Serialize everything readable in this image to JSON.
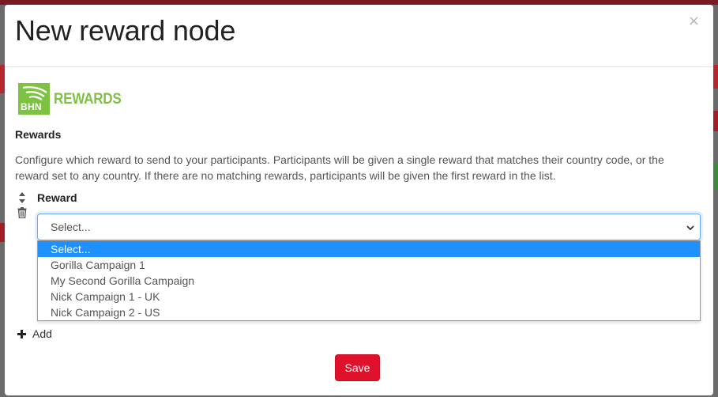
{
  "modal": {
    "title": "New reward node",
    "close_label": "×"
  },
  "logo": {
    "mark_text": "BHN",
    "wordmark": "REWARDS",
    "brand_color": "#7dc242"
  },
  "section": {
    "title": "Rewards",
    "description": "Configure which reward to send to your participants. Participants will be given a single reward that matches their country code, or the reward set to any country. If there are no matching rewards, participants will be given the first reward in the list."
  },
  "reward_field": {
    "label": "Reward",
    "selected_value": "Select...",
    "options": [
      "Select...",
      "Gorilla Campaign 1",
      "My Second Gorilla Campaign",
      "Nick Campaign 1 - UK",
      "Nick Campaign 2 - US"
    ],
    "highlighted_index": 0
  },
  "actions": {
    "add_label": "Add",
    "save_label": "Save"
  },
  "colors": {
    "accent_focus": "#66a8ec",
    "option_highlight": "#1e90ff",
    "save_button": "#e0112b"
  },
  "icons": [
    "sort-handle-icon",
    "trash-icon",
    "chevron-down-icon",
    "plus-icon",
    "close-icon"
  ]
}
